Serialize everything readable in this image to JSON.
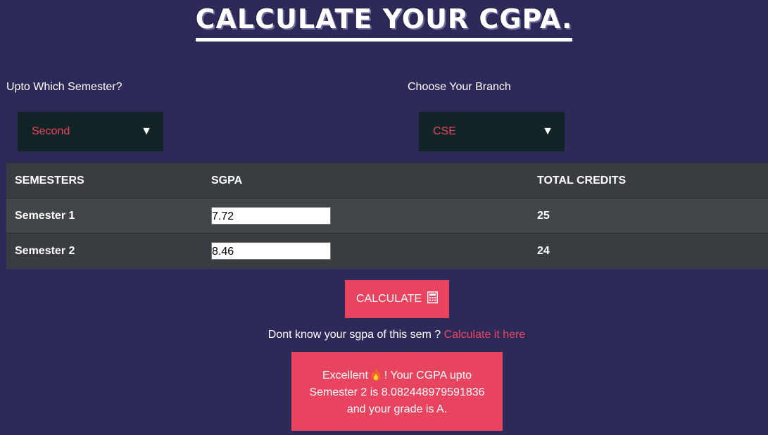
{
  "header": {
    "title": "CALCULATE YOUR CGPA."
  },
  "semester_select": {
    "label": "Upto Which Semester?",
    "value": "Second",
    "arrow": "▼"
  },
  "branch_select": {
    "label": "Choose Your Branch",
    "value": "CSE",
    "arrow": "▼"
  },
  "table": {
    "headers": [
      "SEMESTERS",
      "SGPA",
      "TOTAL CREDITS"
    ],
    "rows": [
      {
        "semester": "Semester 1",
        "sgpa": "7.72",
        "credits": "25"
      },
      {
        "semester": "Semester 2",
        "sgpa": "8.46",
        "credits": "24"
      }
    ]
  },
  "calculate_button": {
    "label": "CALCULATE",
    "icon": "calculator-icon"
  },
  "hint": {
    "text": "Dont know your sgpa of this sem ?",
    "link": "Calculate it here"
  },
  "result": {
    "prefix": "Excellent",
    "icon": "fire-icon",
    "line1_suffix": "! Your CGPA upto",
    "line2": "Semester 2 is 8.082448979591836",
    "line3": "and your grade is A."
  },
  "colors": {
    "background": "#2d2a59",
    "accent": "#e8435f",
    "select_bg": "#122426",
    "table_header": "#393c40"
  }
}
